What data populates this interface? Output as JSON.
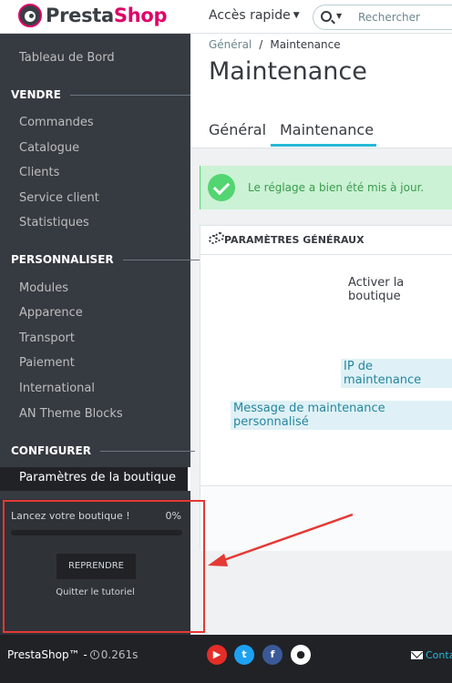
{
  "header": {
    "logo_part1": "Presta",
    "logo_part2": "Shop",
    "quick_access": "Accès rapide",
    "search_placeholder": "Rechercher"
  },
  "sidebar": {
    "dashboard": "Tableau de Bord",
    "sections": [
      {
        "title": "VENDRE",
        "items": [
          "Commandes",
          "Catalogue",
          "Clients",
          "Service client",
          "Statistiques"
        ]
      },
      {
        "title": "PERSONNALISER",
        "items": [
          "Modules",
          "Apparence",
          "Transport",
          "Paiement",
          "International",
          "AN Theme Blocks"
        ]
      },
      {
        "title": "CONFIGURER",
        "items": [
          "Paramètres de la boutique"
        ]
      }
    ],
    "active_item": "Paramètres de la boutique"
  },
  "tutorial": {
    "title": "Lancez votre boutique !",
    "progress_label": "0%",
    "progress": 0,
    "resume_button": "REPRENDRE",
    "quit_link": "Quitter le tutoriel"
  },
  "main": {
    "breadcrumb": [
      "Général",
      "/",
      "Maintenance"
    ],
    "page_title": "Maintenance",
    "tabs": [
      "Général",
      "Maintenance"
    ],
    "active_tab": "Maintenance",
    "alert": "Le réglage a bien été mis à jour.",
    "panel": {
      "title": "PARAMÈTRES GÉNÉRAUX",
      "fields": [
        "Activer la boutique",
        "IP de maintenance",
        "Message de maintenance personnalisé"
      ]
    }
  },
  "footer": {
    "brand": "PrestaShop™",
    "dash": "-",
    "time": "0.261s",
    "contact": "Conta"
  },
  "colors": {
    "sidebar_bg": "#363a41",
    "accent": "#25b9d7",
    "brand_pink": "#df0067",
    "success": "#53d572",
    "annotation_red": "#e53935"
  },
  "icons": [
    "prestashop-logo-icon",
    "search-icon",
    "check-circle-icon",
    "gears-icon",
    "clock-icon",
    "youtube-icon",
    "twitter-icon",
    "facebook-icon",
    "github-icon",
    "envelope-icon"
  ]
}
